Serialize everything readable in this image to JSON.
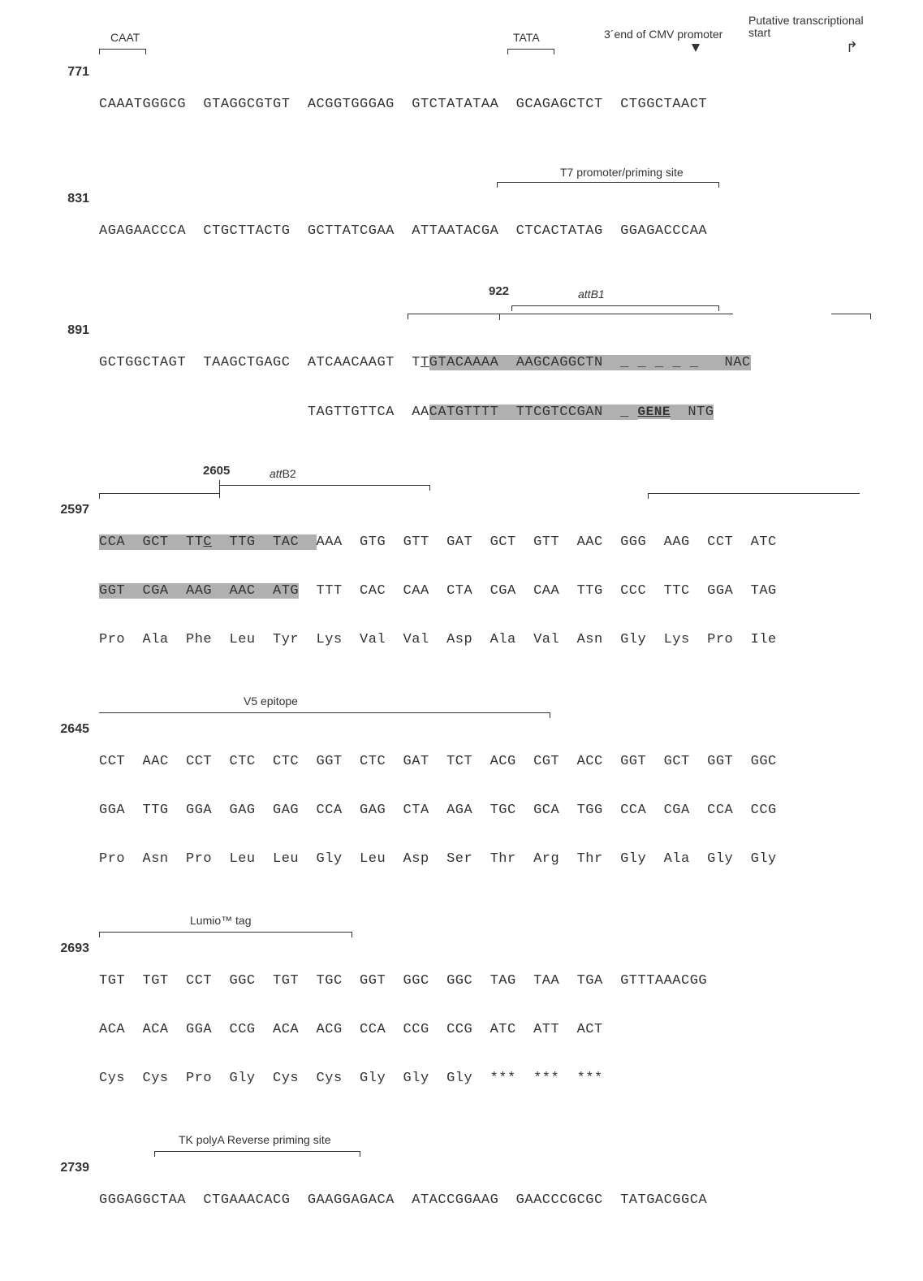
{
  "labels": {
    "caat": "CAAT",
    "tata": "TATA",
    "cmv3": "3´end of CMV promoter",
    "putative": "Putative transcriptional start",
    "t7": "T7 promoter/priming site",
    "p922": "922",
    "attB1": "attB1",
    "gene": "GENE",
    "p2605": "2605",
    "attB2": "attB2",
    "v5": "V5 epitope",
    "lumio": "Lumio™ tag",
    "tkpoly": "TK polyA Reverse priming site"
  },
  "rows": {
    "r771": {
      "pos": "771",
      "seq": "CAAATGGGCG  GTAGGCGTGT  ACGGTGGGAG  GTCTATATAA  GCAGAGCTCT  CTGGCTAACT"
    },
    "r831": {
      "pos": "831",
      "seq": "AGAGAACCCA  CTGCTTACTG  GCTTATCGAA  ATTAATACGA  CTCACTATAG  GGAGACCCAA"
    },
    "r891": {
      "pos": "891",
      "top_a": "GCTGGCTAGT  TAAGCTGAGC  ATCAACAAGT  T",
      "top_b": "T",
      "top_c": "GTACAAAA  AAGCAGGCTN  ",
      "top_d": "_ _ _ _ _   ",
      "top_e": "NAC",
      "bot_a": "                        TAGTTGTTCA  AA",
      "bot_b": "CATGTTTT  TTCGTCCGAN  ",
      "bot_d": "_ ",
      "bot_e": "  NTG"
    },
    "r2597": {
      "pos": "2597",
      "top_a": "CCA  GCT  TT",
      "top_b": "C",
      "top_c": "  TTG  TAC  ",
      "top_d": "AAA  GTG  GTT  GAT  GCT  GTT  AAC  GGG  AAG  CCT  ATC",
      "bot_a": "GGT  CGA  AAG  AAC  ATG",
      "bot_b": "  TTT  CAC  CAA  CTA  CGA  CAA  TTG  CCC  TTC  GGA  TAG",
      "aa": "Pro  Ala  Phe  Leu  Tyr  Lys  Val  Val  Asp  Ala  Val  Asn  Gly  Lys  Pro  Ile"
    },
    "r2645": {
      "pos": "2645",
      "top": "CCT  AAC  CCT  CTC  CTC  GGT  CTC  GAT  TCT  ACG  CGT  ACC  GGT  GCT  GGT  GGC",
      "bot": "GGA  TTG  GGA  GAG  GAG  CCA  GAG  CTA  AGA  TGC  GCA  TGG  CCA  CGA  CCA  CCG",
      "aa": "Pro  Asn  Pro  Leu  Leu  Gly  Leu  Asp  Ser  Thr  Arg  Thr  Gly  Ala  Gly  Gly"
    },
    "r2693": {
      "pos": "2693",
      "top": "TGT  TGT  CCT  GGC  TGT  TGC  GGT  GGC  GGC  TAG  TAA  TGA  GTTTAAACGG",
      "bot": "ACA  ACA  GGA  CCG  ACA  ACG  CCA  CCG  CCG  ATC  ATT  ACT",
      "aa": "Cys  Cys  Pro  Gly  Cys  Cys  Gly  Gly  Gly  ***  ***  ***"
    },
    "r2739": {
      "pos": "2739",
      "seq": "GGGAGGCTAA  CTGAAACACG  GAAGGAGACA  ATACCGGAAG  GAACCCGCGC  TATGACGGCA"
    }
  }
}
